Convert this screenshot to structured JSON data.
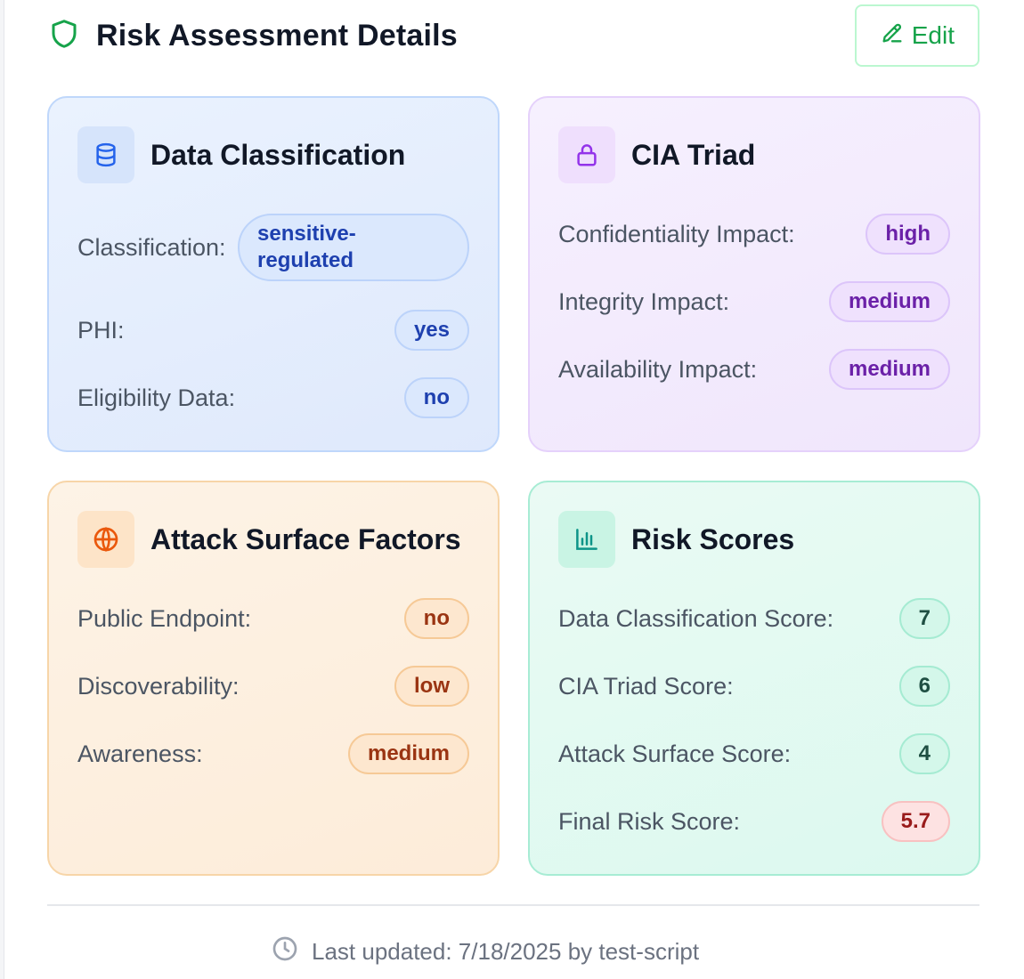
{
  "header": {
    "title": "Risk Assessment Details",
    "edit_label": "Edit",
    "shield_icon": "shield-icon",
    "edit_icon": "pencil-icon"
  },
  "colors": {
    "accent_green": "#16a34a",
    "blue_card": "#eaf2fe",
    "purple_card": "#f6f0fe",
    "orange_card": "#fdf3e6",
    "green_card": "#eafaf4",
    "final_score_badge": "#fde2e2"
  },
  "data_classification": {
    "title": "Data Classification",
    "icon": "database-icon",
    "rows": [
      {
        "label": "Classification:",
        "value": "sensitive-regulated"
      },
      {
        "label": "PHI:",
        "value": "yes"
      },
      {
        "label": "Eligibility Data:",
        "value": "no"
      }
    ]
  },
  "cia_triad": {
    "title": "CIA Triad",
    "icon": "lock-icon",
    "rows": [
      {
        "label": "Confidentiality Impact:",
        "value": "high"
      },
      {
        "label": "Integrity Impact:",
        "value": "medium"
      },
      {
        "label": "Availability Impact:",
        "value": "medium"
      }
    ]
  },
  "attack_surface": {
    "title": "Attack Surface Factors",
    "icon": "globe-icon",
    "rows": [
      {
        "label": "Public Endpoint:",
        "value": "no"
      },
      {
        "label": "Discoverability:",
        "value": "low"
      },
      {
        "label": "Awareness:",
        "value": "medium"
      }
    ]
  },
  "risk_scores": {
    "title": "Risk Scores",
    "icon": "bar-chart-icon",
    "rows": [
      {
        "label": "Data Classification Score:",
        "value": "7"
      },
      {
        "label": "CIA Triad Score:",
        "value": "6"
      },
      {
        "label": "Attack Surface Score:",
        "value": "4"
      },
      {
        "label": "Final Risk Score:",
        "value": "5.7"
      }
    ]
  },
  "footer": {
    "text": "Last updated: 7/18/2025 by test-script",
    "icon": "clock-icon"
  }
}
